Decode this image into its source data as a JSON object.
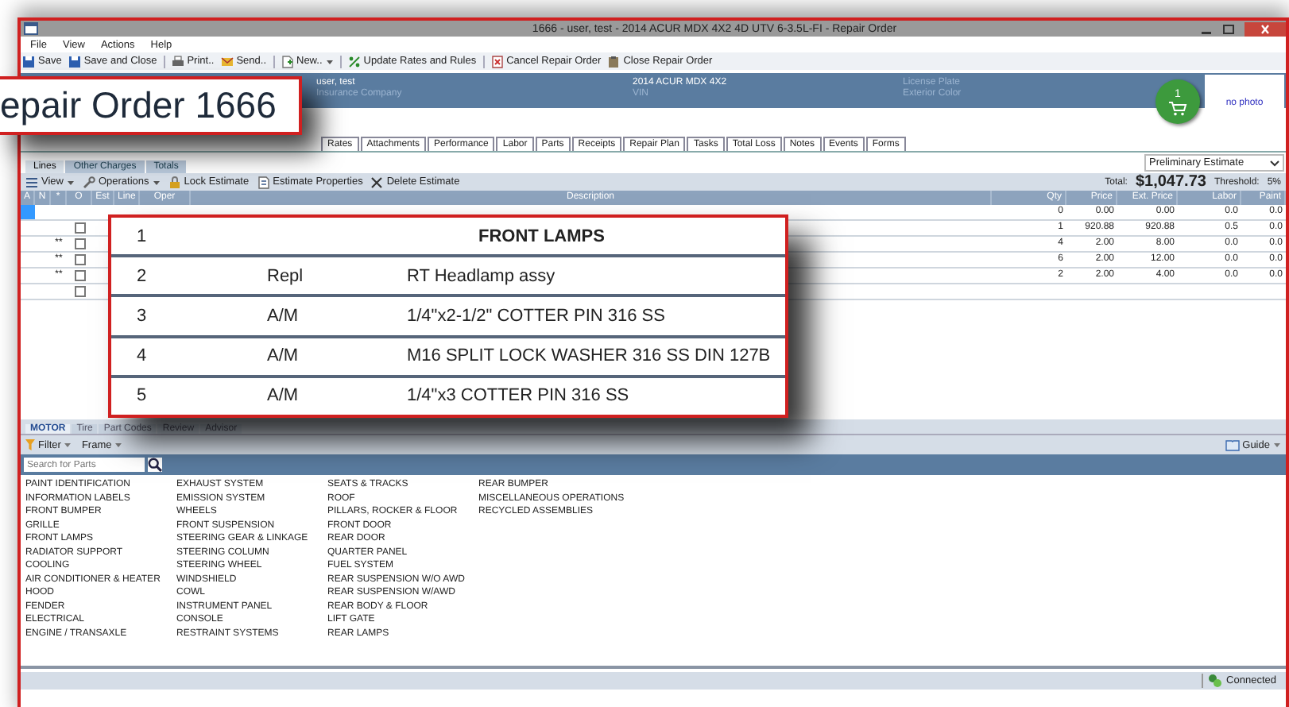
{
  "window": {
    "title": "1666 - user, test - 2014 ACUR MDX 4X2 4D UTV 6-3.5L-FI - Repair Order"
  },
  "menu": [
    "File",
    "View",
    "Actions",
    "Help"
  ],
  "toolbar": [
    {
      "label": "Save",
      "kind": "save"
    },
    {
      "label": "Save and Close",
      "kind": "save"
    },
    {
      "label": "Print..",
      "kind": "print",
      "separated": true
    },
    {
      "label": "Send..",
      "kind": "send"
    },
    {
      "label": "New..",
      "kind": "new",
      "separated": true,
      "dropdown": true
    },
    {
      "label": "Update Rates and Rules",
      "kind": "update",
      "separated": true
    },
    {
      "label": "Cancel Repair Order",
      "kind": "cancel",
      "separated": true
    },
    {
      "label": "Close Repair Order",
      "kind": "close"
    }
  ],
  "header": {
    "customer": "user, test",
    "customer_sub": "Insurance Company",
    "vehicle": "2014 ACUR MDX 4X2",
    "vehicle_sub": "VIN",
    "plate_label": "License Plate",
    "color_label": "Exterior Color",
    "cart_count": "1",
    "photo": "no photo"
  },
  "tabs": [
    {
      "label": "Rates",
      "selected": false
    },
    {
      "label": "Attachments",
      "selected": false
    },
    {
      "label": "Performance",
      "selected": false
    },
    {
      "label": "Labor",
      "selected": false
    },
    {
      "label": "Parts",
      "selected": false
    },
    {
      "label": "Receipts",
      "selected": false
    },
    {
      "label": "Repair Plan",
      "selected": false
    },
    {
      "label": "Tasks",
      "selected": false
    },
    {
      "label": "Total Loss",
      "selected": false
    },
    {
      "label": "Notes",
      "selected": false
    },
    {
      "label": "Events",
      "selected": false
    },
    {
      "label": "Forms",
      "selected": false
    }
  ],
  "subtabs": [
    {
      "label": "Lines",
      "selected": true
    },
    {
      "label": "Other Charges",
      "selected": false
    },
    {
      "label": "Totals",
      "selected": false
    }
  ],
  "estimate_select": {
    "value": "Preliminary Estimate"
  },
  "estimate_toolbar": [
    {
      "label": "View",
      "kind": "view",
      "dropdown": true
    },
    {
      "label": "Operations",
      "kind": "operations",
      "dropdown": true
    },
    {
      "label": "Lock Estimate",
      "kind": "lock"
    },
    {
      "label": "Estimate Properties",
      "kind": "properties"
    },
    {
      "label": "Delete Estimate",
      "kind": "delete"
    }
  ],
  "totals": {
    "total_label": "Total:",
    "total": "$1,047.73",
    "threshold_label": "Threshold:",
    "threshold": "5%"
  },
  "table": {
    "columns": [
      "A",
      "N",
      "*",
      "O",
      "Est",
      "Line",
      "Oper",
      "Description",
      "Qty",
      "Price",
      "Ext. Price",
      "Labor",
      "Paint"
    ],
    "rows": [
      {
        "kind": "header",
        "selected": true,
        "qty": "0",
        "price": "0.00",
        "ext_price": "0.00",
        "labor": "0.0",
        "paint": "0.0"
      },
      {
        "kind": "item",
        "selected": false,
        "checked": false,
        "qty": "1",
        "price": "920.88",
        "ext_price": "920.88",
        "labor": "0.5",
        "paint": "0.0"
      },
      {
        "kind": "item",
        "selected": false,
        "checked": false,
        "marker": "**",
        "qty": "4",
        "price": "2.00",
        "ext_price": "8.00",
        "labor": "0.0",
        "paint": "0.0"
      },
      {
        "kind": "item",
        "selected": false,
        "checked": false,
        "marker": "**",
        "qty": "6",
        "price": "2.00",
        "ext_price": "12.00",
        "labor": "0.0",
        "paint": "0.0"
      },
      {
        "kind": "item",
        "selected": false,
        "checked": false,
        "marker": "**",
        "qty": "2",
        "price": "2.00",
        "ext_price": "4.00",
        "labor": "0.0",
        "paint": "0.0"
      },
      {
        "kind": "blank",
        "selected": false,
        "checked": false
      }
    ]
  },
  "callout_title": "epair Order 1666",
  "callout_rows": [
    {
      "kind": "header",
      "line": "1",
      "description": "FRONT LAMPS"
    },
    {
      "kind": "item",
      "line": "2",
      "oper": "Repl",
      "description": "RT Headlamp assy"
    },
    {
      "kind": "item",
      "line": "3",
      "oper": "A/M",
      "description": "1/4\"x2-1/2\" COTTER PIN 316 SS"
    },
    {
      "kind": "item",
      "line": "4",
      "oper": "A/M",
      "description": "M16 SPLIT LOCK WASHER 316 SS DIN 127B"
    },
    {
      "kind": "item",
      "line": "5",
      "oper": "A/M",
      "description": "1/4\"x3 COTTER PIN 316 SS"
    }
  ],
  "parts_tabs": [
    {
      "label": "MOTOR",
      "selected": true
    },
    {
      "label": "Tire",
      "selected": false
    },
    {
      "label": "Part Codes",
      "selected": false
    },
    {
      "label": "Review",
      "selected": false
    },
    {
      "label": "Advisor",
      "selected": false
    }
  ],
  "parts_toolbar": [
    {
      "label": "Filter",
      "kind": "filter"
    },
    {
      "label": "Frame",
      "kind": "frame"
    }
  ],
  "guide": "Guide",
  "parts_search": {
    "placeholder": "Search for Parts"
  },
  "part_groups": [
    [
      "PAINT IDENTIFICATION",
      "INFORMATION LABELS",
      "FRONT BUMPER",
      "GRILLE",
      "FRONT LAMPS",
      "RADIATOR SUPPORT",
      "COOLING",
      "AIR CONDITIONER & HEATER",
      "HOOD",
      "FENDER",
      "ELECTRICAL",
      "ENGINE / TRANSAXLE"
    ],
    [
      "EXHAUST SYSTEM",
      "EMISSION SYSTEM",
      "WHEELS",
      "FRONT SUSPENSION",
      "STEERING GEAR & LINKAGE",
      "STEERING COLUMN",
      "STEERING WHEEL",
      "WINDSHIELD",
      "COWL",
      "INSTRUMENT PANEL",
      "CONSOLE",
      "RESTRAINT SYSTEMS"
    ],
    [
      "SEATS & TRACKS",
      "ROOF",
      "PILLARS, ROCKER & FLOOR",
      "FRONT DOOR",
      "REAR DOOR",
      "QUARTER PANEL",
      "FUEL SYSTEM",
      "REAR SUSPENSION W/O AWD",
      "REAR SUSPENSION W/AWD",
      "REAR BODY & FLOOR",
      "LIFT GATE",
      "REAR LAMPS"
    ],
    [
      "REAR BUMPER",
      "MISCELLANEOUS OPERATIONS",
      "RECYCLED ASSEMBLIES"
    ]
  ],
  "status": "Connected"
}
